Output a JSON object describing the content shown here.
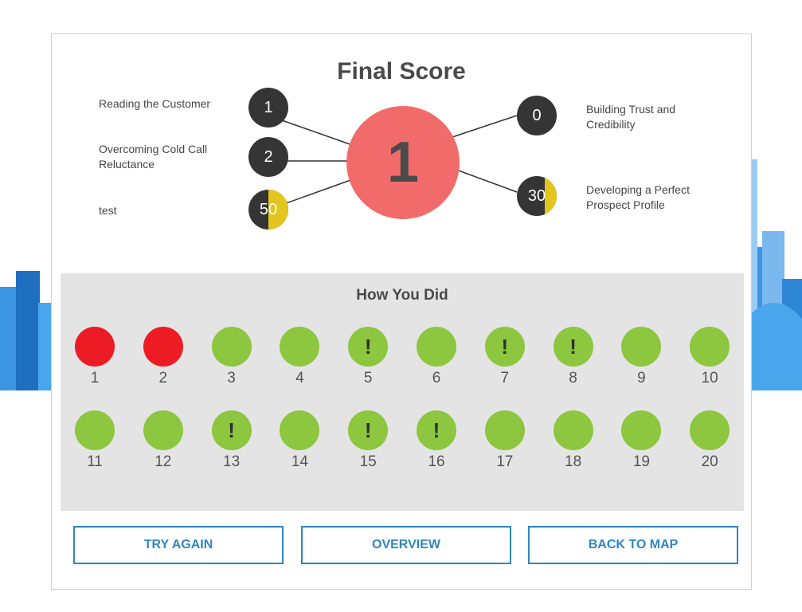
{
  "title": "Final Score",
  "main_score": "1",
  "skills": [
    {
      "label": "Reading the Customer",
      "value": "1",
      "fill": 0
    },
    {
      "label": "Overcoming Cold Call Reluctance",
      "value": "2",
      "fill": 0
    },
    {
      "label": "test",
      "value": "50",
      "fill": 0.5
    },
    {
      "label": "Building Trust and Credibility",
      "value": "0",
      "fill": 0
    },
    {
      "label": "Developing a Perfect Prospect Profile",
      "value": "30",
      "fill": 0.3
    }
  ],
  "results_title": "How You Did",
  "questions": [
    {
      "num": "1",
      "status": "incorrect"
    },
    {
      "num": "2",
      "status": "incorrect"
    },
    {
      "num": "3",
      "status": "correct"
    },
    {
      "num": "4",
      "status": "correct"
    },
    {
      "num": "5",
      "status": "partial",
      "mark": "!"
    },
    {
      "num": "6",
      "status": "correct"
    },
    {
      "num": "7",
      "status": "partial",
      "mark": "!"
    },
    {
      "num": "8",
      "status": "partial",
      "mark": "!"
    },
    {
      "num": "9",
      "status": "correct"
    },
    {
      "num": "10",
      "status": "correct"
    },
    {
      "num": "11",
      "status": "correct"
    },
    {
      "num": "12",
      "status": "correct"
    },
    {
      "num": "13",
      "status": "partial",
      "mark": "!"
    },
    {
      "num": "14",
      "status": "correct"
    },
    {
      "num": "15",
      "status": "partial",
      "mark": "!"
    },
    {
      "num": "16",
      "status": "partial",
      "mark": "!"
    },
    {
      "num": "17",
      "status": "correct"
    },
    {
      "num": "18",
      "status": "correct"
    },
    {
      "num": "19",
      "status": "correct"
    },
    {
      "num": "20",
      "status": "correct"
    }
  ],
  "buttons": {
    "try_again": "TRY AGAIN",
    "overview": "OVERVIEW",
    "back_to_map": "BACK TO MAP"
  },
  "colors": {
    "correct": "#8dc63f",
    "incorrect": "#ed1c24",
    "main_score": "#f26b6b",
    "accent": "#2e86c1",
    "gauge_fill": "#e3c61d"
  }
}
